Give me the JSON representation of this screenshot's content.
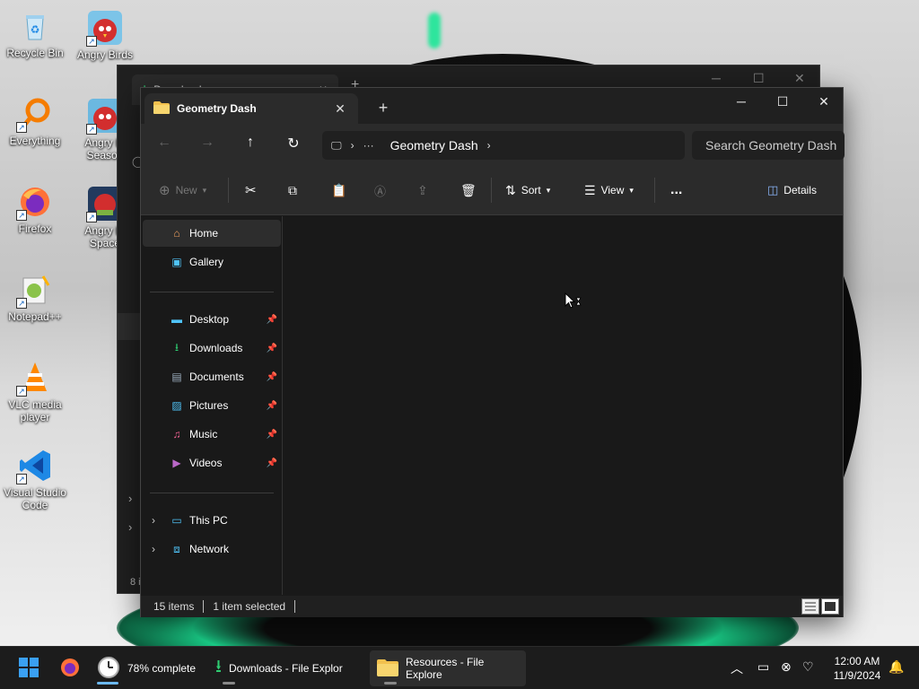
{
  "desktop": {
    "icons": [
      {
        "label": "Recycle Bin",
        "icon": "recycle-bin-icon"
      },
      {
        "label": "Angry Birds",
        "icon": "angry-birds-icon"
      },
      {
        "label": "Everything",
        "icon": "everything-search-icon"
      },
      {
        "label": "Angry Bi Season",
        "icon": "angry-birds-seasons-icon"
      },
      {
        "label": "Firefox",
        "icon": "firefox-icon"
      },
      {
        "label": "Angry Bi Space",
        "icon": "angry-birds-space-icon"
      },
      {
        "label": "Notepad++",
        "icon": "notepad-plus-plus-icon"
      },
      {
        "label": "VLC media player",
        "icon": "vlc-icon"
      },
      {
        "label": "Visual Studio Code",
        "icon": "vscode-icon"
      }
    ]
  },
  "background_window": {
    "tab_title": "Downloads",
    "status": "8 i"
  },
  "window": {
    "tab_title": "Geometry Dash",
    "new_tab_label": "+",
    "breadcrumb": [
      "Geometry Dash"
    ],
    "search_placeholder": "Search Geometry Dash",
    "toolbar": {
      "new_label": "New",
      "sort_label": "Sort",
      "view_label": "View",
      "details_label": "Details",
      "more_label": "..."
    },
    "nav": {
      "quick": [
        {
          "label": "Home",
          "icon": "home-icon",
          "selected": true
        },
        {
          "label": "Gallery",
          "icon": "gallery-icon"
        }
      ],
      "pinned": [
        {
          "label": "Desktop",
          "icon": "desktop-folder-icon"
        },
        {
          "label": "Downloads",
          "icon": "downloads-folder-icon"
        },
        {
          "label": "Documents",
          "icon": "documents-folder-icon"
        },
        {
          "label": "Pictures",
          "icon": "pictures-folder-icon"
        },
        {
          "label": "Music",
          "icon": "music-folder-icon"
        },
        {
          "label": "Videos",
          "icon": "videos-folder-icon"
        }
      ],
      "locations": [
        {
          "label": "This PC",
          "icon": "this-pc-icon"
        },
        {
          "label": "Network",
          "icon": "network-icon"
        }
      ]
    },
    "status": {
      "items": "15 items",
      "selected": "1 item selected"
    }
  },
  "taskbar": {
    "apps": [
      {
        "label": "78% complete",
        "icon": "clock-progress-icon"
      },
      {
        "label": "Downloads - File Explor",
        "icon": "downloads-arrow-icon"
      },
      {
        "label": "Resources - File Explore",
        "icon": "file-explorer-icon",
        "active": true
      }
    ],
    "time": "12:00 AM",
    "date": "11/9/2024"
  },
  "colors": {
    "accent_green": "#2ee59d",
    "window_bg": "#191919",
    "folder_yellow": "#f2c14e",
    "start_blue": "#3aa0f3"
  }
}
